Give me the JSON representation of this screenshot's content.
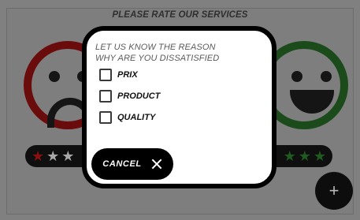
{
  "screen": {
    "title": "PLEASE RATE OUR SERVICES"
  },
  "faces": {
    "left": {
      "icon": "sad-face-icon",
      "color": "#6b0c0c"
    },
    "right": {
      "icon": "happy-face-icon",
      "color": "#1b4b1b"
    }
  },
  "ratings": {
    "left": {
      "filled": 1,
      "visible_stars": 3,
      "filled_color": "#8a1010",
      "empty_color": "#a8a8a8"
    },
    "right": {
      "filled": 3,
      "visible_stars": 3,
      "filled_color": "#1f5a1f",
      "empty_color": "#a8a8a8"
    }
  },
  "fab": {
    "icon": "plus-icon",
    "label": "+"
  },
  "dialog": {
    "heading_line1": "LET US KNOW THE REASON",
    "heading_line2": "WHY ARE YOU DISSATISFIED",
    "options": [
      {
        "label": "PRIX",
        "checked": false
      },
      {
        "label": "PRODUCT",
        "checked": false
      },
      {
        "label": "QUALITY",
        "checked": false
      }
    ],
    "cancel_label": "CANCEL"
  }
}
